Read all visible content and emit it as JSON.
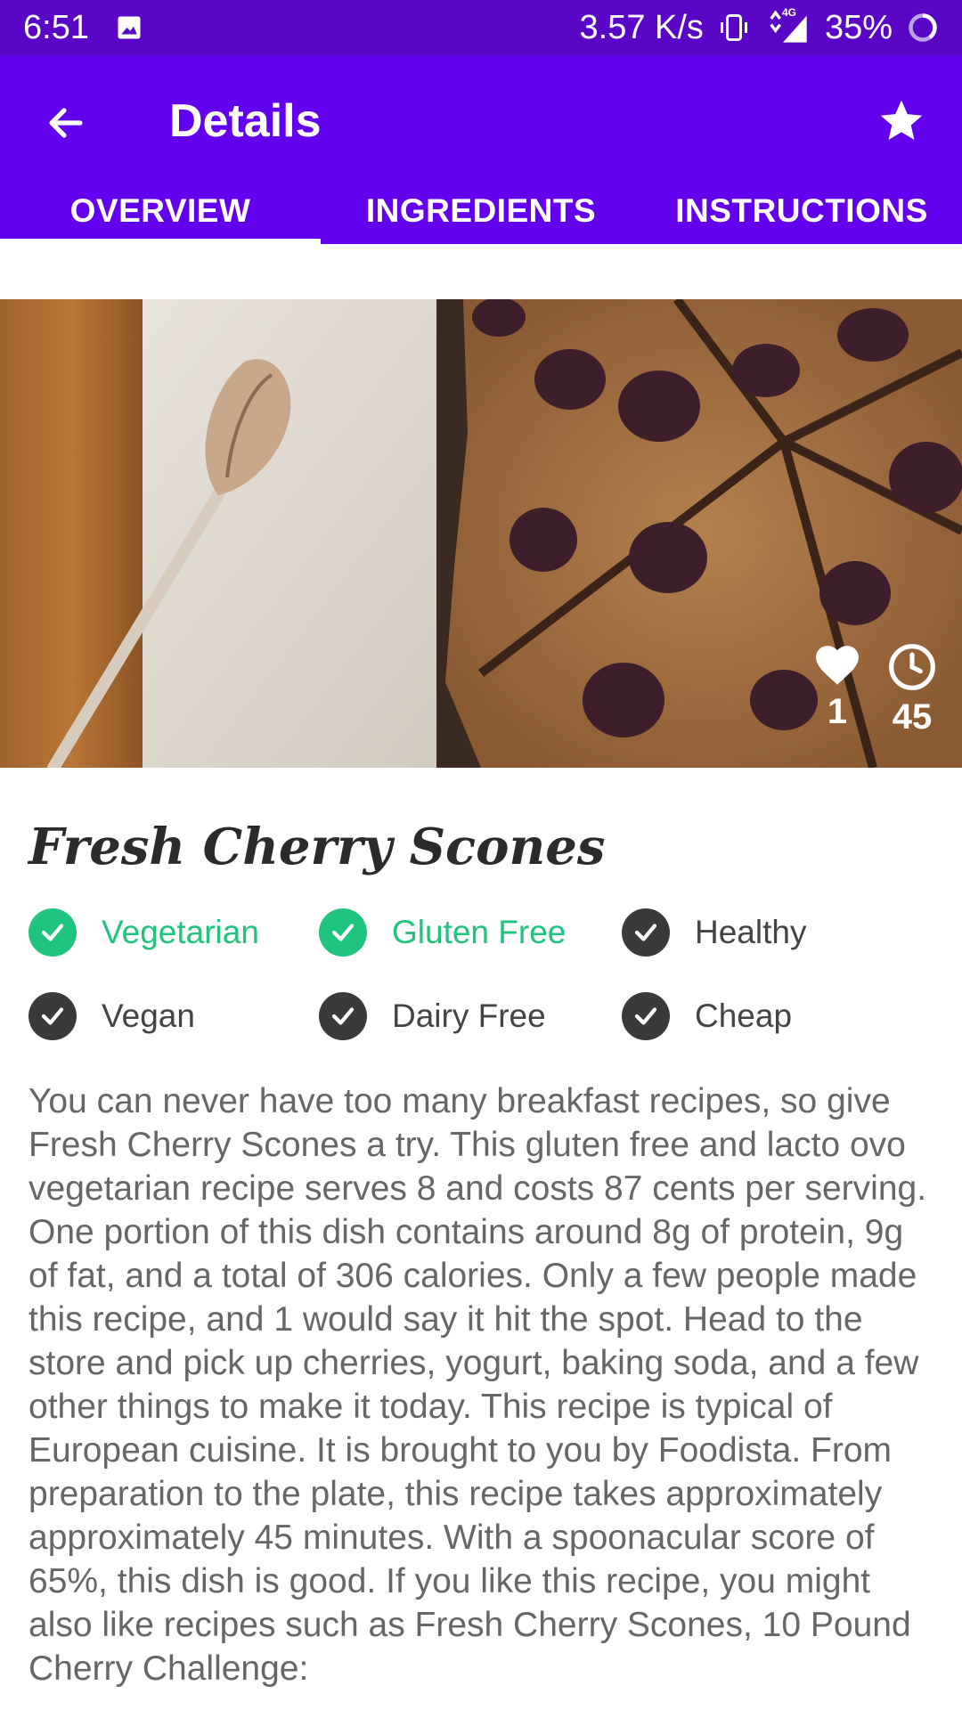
{
  "status_bar": {
    "time": "6:51",
    "network_speed": "3.57 K/s",
    "network_type": "4G",
    "battery": "35%"
  },
  "app_bar": {
    "title": "Details"
  },
  "tabs": [
    {
      "label": "OVERVIEW",
      "active": true
    },
    {
      "label": "INGREDIENTS",
      "active": false
    },
    {
      "label": "INSTRUCTIONS",
      "active": false
    }
  ],
  "hero": {
    "likes": "1",
    "minutes": "45"
  },
  "recipe": {
    "title": "Fresh Cherry Scones",
    "diets": [
      {
        "label": "Vegetarian",
        "checked": true
      },
      {
        "label": "Gluten Free",
        "checked": true
      },
      {
        "label": "Healthy",
        "checked": false
      },
      {
        "label": "Vegan",
        "checked": false
      },
      {
        "label": "Dairy Free",
        "checked": false
      },
      {
        "label": "Cheap",
        "checked": false
      }
    ],
    "summary": "You can never have too many breakfast recipes, so give Fresh Cherry Scones a try. This gluten free and lacto ovo vegetarian recipe serves 8 and costs 87 cents per serving. One portion of this dish contains around 8g of protein, 9g of fat, and a total of 306 calories. Only a few people made this recipe, and 1 would say it hit the spot. Head to the store and pick up cherries, yogurt, baking soda, and a few other things to make it today. This recipe is typical of European cuisine. It is brought to you by Foodista. From preparation to the plate, this recipe takes approximately approximately 45 minutes. With a spoonacular score of 65%, this dish is good. If you like this recipe, you might also like recipes such as Fresh Cherry Scones, 10 Pound Cherry Challenge:"
  },
  "colors": {
    "status_bar": "#5a06c6",
    "primary": "#6200ee",
    "checked_green": "#1fc47e",
    "unchecked": "#3a3a3a"
  }
}
